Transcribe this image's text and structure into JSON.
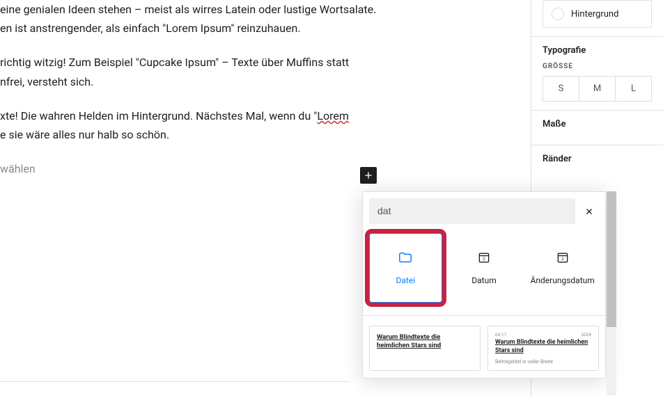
{
  "content": {
    "p1a": "eine genialen Ideen stehen – meist als wirres Latein oder lustige Wortsalate.",
    "p1b": "en ist anstrengender, als einfach \"Lorem Ipsum\" reinzuhauen.",
    "p2a": "richtig witzig! Zum Beispiel \"Cupcake Ipsum\" – Texte über Muffins statt",
    "p2b": "nfrei, versteht sich.",
    "p3a_prefix": "xte! Die wahren Helden im Hintergrund. Nächstes Mal, wenn du \"",
    "p3a_wavy": "Lorem",
    "p3b": "e sie wäre alles nur halb so schön.",
    "placeholder": "wählen"
  },
  "sidebar": {
    "hintergrund": "Hintergrund",
    "typografie_title": "Typografie",
    "groesse_label": "GRÖSSE",
    "sizes": {
      "s": "S",
      "m": "M",
      "l": "L"
    },
    "masse_title": "Maße",
    "raender_title": "Ränder"
  },
  "inserter": {
    "search_value": "dat",
    "blocks": {
      "datei": "Datei",
      "datum": "Datum",
      "aenderungsdatum": "Änderungsdatum"
    },
    "patterns": {
      "card1": {
        "meta_left": "",
        "meta_right": "",
        "title": "Warum Blindtexte die heimlichen Stars sind",
        "sub": ""
      },
      "card2": {
        "meta_left": "04.17",
        "meta_right": "2024",
        "title": "Warum Blindtexte die heimlichen Stars sind",
        "sub": "Beitragstitel in voller Breite"
      }
    }
  }
}
